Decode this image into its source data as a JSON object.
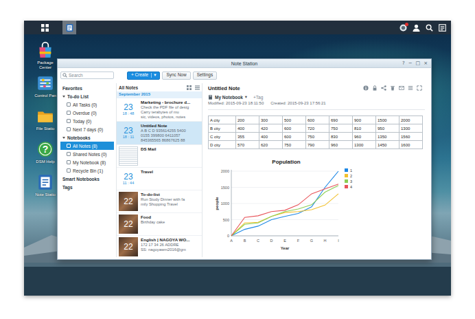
{
  "taskbar": {
    "apps": [
      {
        "kind": "note-station",
        "selected": true
      }
    ],
    "notification_badge": true
  },
  "desktop_icons": [
    {
      "label": "Package Center",
      "kind": "package"
    },
    {
      "label": "Control Pan",
      "kind": "control"
    },
    {
      "label": "File Statio",
      "kind": "file"
    },
    {
      "label": "DSM Help",
      "kind": "help",
      "glyph": "?"
    },
    {
      "label": "Note Statio",
      "kind": "note"
    }
  ],
  "window": {
    "title": "Note Station",
    "controls": [
      "?",
      "−",
      "□",
      "×"
    ]
  },
  "toolbar": {
    "search": {
      "placeholder": "Search"
    },
    "buttons": [
      {
        "label": "+ Create",
        "primary": true,
        "dropdown": "▾"
      },
      {
        "label": "Sync Now",
        "primary": false
      },
      {
        "label": "Settings",
        "primary": false
      }
    ]
  },
  "sidebar": {
    "items": [
      {
        "label": "Favorites",
        "kind": "header",
        "selected": false
      },
      {
        "label": "To-do List",
        "kind": "group",
        "expanded": true,
        "selected": false
      },
      {
        "label": "All Tasks (0)",
        "kind": "item",
        "selected": false
      },
      {
        "label": "Overdue (0)",
        "kind": "item",
        "selected": false
      },
      {
        "label": "Today (0)",
        "kind": "item",
        "selected": false
      },
      {
        "label": "Next 7 days (0)",
        "kind": "item",
        "selected": false
      },
      {
        "label": "Notebooks",
        "kind": "group",
        "expanded": true,
        "selected": false
      },
      {
        "label": "All Notes (8)",
        "kind": "item",
        "selected": true
      },
      {
        "label": "Shared Notes (0)",
        "kind": "item",
        "selected": false
      },
      {
        "label": "My Notebook (8)",
        "kind": "item",
        "selected": false
      },
      {
        "label": "Recycle Bin (1)",
        "kind": "item",
        "selected": false
      },
      {
        "label": "Smart Notebooks",
        "kind": "header",
        "selected": false
      },
      {
        "label": "Tags",
        "kind": "header",
        "selected": false
      }
    ]
  },
  "note_list": {
    "header": "All Notes",
    "group": "September 2015",
    "notes": [
      {
        "kind": "date",
        "day": "23",
        "time": "18 : 48",
        "title": "Marketing - brochure d...",
        "snippet": [
          "Check the PDF file of desig",
          "Carry terabytes of mu",
          "sic, videos, photos, notes"
        ],
        "selected": false
      },
      {
        "kind": "date",
        "day": "23",
        "time": "18 : 11",
        "title": "Untitled Note",
        "snippet": [
          "A B C D 935614255 5400",
          "0155 399800 6411057",
          "845365565 86867625 88"
        ],
        "selected": true
      },
      {
        "kind": "screenshot",
        "title": "DS Mail",
        "snippet": [],
        "selected": false
      },
      {
        "kind": "date",
        "day": "23",
        "time": "11 : 44",
        "title": "Travel",
        "snippet": [],
        "selected": false
      },
      {
        "kind": "photo",
        "day": "22",
        "title": "To-do-list",
        "snippet": [
          "Run Study Dinner with fa",
          "mily Shopping Travel"
        ],
        "selected": false
      },
      {
        "kind": "photo",
        "day": "22",
        "title": "Food",
        "snippet": [
          "Birthday cake"
        ],
        "selected": false
      },
      {
        "kind": "photo",
        "day": "22",
        "title": "English | NAGOYA WO...",
        "snippet": [
          "172 17 34 26 ADDRE",
          "SS: nagoyawm2016@gm"
        ],
        "selected": false
      }
    ]
  },
  "note": {
    "title": "Untitled Note",
    "notebook": "My Notebook",
    "notebook_menu": "▾",
    "tag": "+Tag",
    "modified": "Modified: 2015-09-23 18:11:50",
    "created": "Created: 2015-09-23 17:56:21",
    "table": {
      "rows": [
        [
          "A city",
          "200",
          "300",
          "500",
          "600",
          "690",
          "900",
          "1500",
          "2000"
        ],
        [
          "B city",
          "400",
          "420",
          "600",
          "720",
          "750",
          "810",
          "950",
          "1300"
        ],
        [
          "C city",
          "355",
          "400",
          "600",
          "750",
          "830",
          "960",
          "1350",
          "1560"
        ],
        [
          "D city",
          "570",
          "620",
          "750",
          "790",
          "960",
          "1300",
          "1450",
          "1600"
        ]
      ]
    },
    "chart": {
      "title": "Population",
      "y_label": "people",
      "x_label": "Year",
      "y_ticks": [
        "0",
        "500",
        "1000",
        "1500",
        "2000"
      ],
      "x_ticks": [
        "A",
        "B",
        "C",
        "D",
        "E",
        "F",
        "G",
        "H",
        "I"
      ],
      "series": [
        {
          "name": "1",
          "color": "#1e88e5",
          "values": [
            0,
            200,
            300,
            500,
            600,
            690,
            900,
            1500,
            2000
          ]
        },
        {
          "name": "2",
          "color": "#f2c12e",
          "values": [
            0,
            400,
            420,
            600,
            720,
            750,
            810,
            950,
            1300
          ]
        },
        {
          "name": "3",
          "color": "#8dcf55",
          "values": [
            0,
            355,
            400,
            600,
            750,
            830,
            960,
            1350,
            1560
          ]
        },
        {
          "name": "4",
          "color": "#e8545a",
          "values": [
            0,
            570,
            620,
            750,
            790,
            960,
            1300,
            1450,
            1600
          ]
        }
      ]
    }
  }
}
